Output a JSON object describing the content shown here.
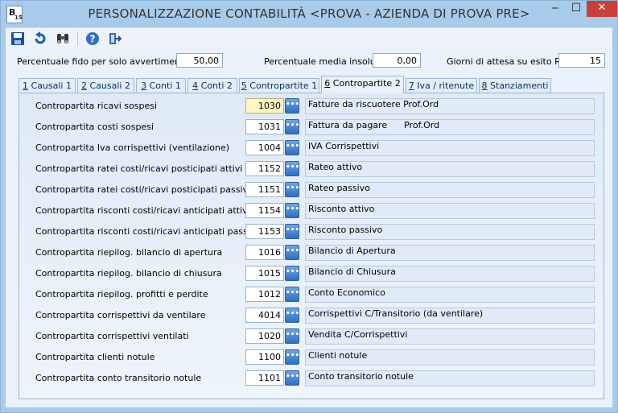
{
  "window": {
    "title": "PERSONALIZZAZIONE CONTABILITÀ <PROVA - AZIENDA DI PROVA PRE>",
    "icon_letter": "B",
    "icon_number": "15",
    "minimize_glyph": "‒",
    "maximize_glyph": "☐",
    "close_glyph": "✕"
  },
  "toolbar": {
    "icons": [
      "save-icon",
      "undo-icon",
      "binoculars-icon",
      "help-icon",
      "exit-icon"
    ]
  },
  "header_fields": [
    {
      "label": "Percentuale fido per solo avvertimento",
      "value": "50,00"
    },
    {
      "label": "Percentuale media insoluti",
      "value": "0,00"
    },
    {
      "label": "Giorni di attesa su esito RB",
      "value": "15"
    }
  ],
  "tabs": [
    {
      "num": "1",
      "label": " Causali 1"
    },
    {
      "num": "2",
      "label": " Causali 2"
    },
    {
      "num": "3",
      "label": " Conti 1"
    },
    {
      "num": "4",
      "label": " Conti 2"
    },
    {
      "num": "5",
      "label": " Contropartite 1"
    },
    {
      "num": "6",
      "label": " Contropartite 2"
    },
    {
      "num": "7",
      "label": " Iva / ritenute"
    },
    {
      "num": "8",
      "label": " Stanziamenti"
    }
  ],
  "active_tab_index": 5,
  "rows": [
    {
      "label": "Contropartita ricavi sospesi",
      "code": "1030",
      "description": "Fatture da riscuotere Prof.Ord"
    },
    {
      "label": "Contropartita costi sospesi",
      "code": "1031",
      "description": "Fattura da pagare      Prof.Ord"
    },
    {
      "label": "Contropartita Iva corrispettivi (ventilazione)",
      "code": "1004",
      "description": "IVA Corrispettivi"
    },
    {
      "label": "Contropartita ratei costi/ricavi posticipati attivi",
      "code": "1152",
      "description": "Rateo attivo"
    },
    {
      "label": "Contropartita ratei costi/ricavi posticipati passivi",
      "code": "1151",
      "description": "Rateo passivo"
    },
    {
      "label": "Contropartita risconti costi/ricavi anticipati attivi",
      "code": "1154",
      "description": "Risconto attivo"
    },
    {
      "label": "Contropartita risconti costi/ricavi anticipati passivi",
      "code": "1153",
      "description": "Risconto passivo"
    },
    {
      "label": "Contropartita riepilog. bilancio di apertura",
      "code": "1016",
      "description": "Bilancio di Apertura"
    },
    {
      "label": "Contropartita riepilog. bilancio di chiusura",
      "code": "1015",
      "description": "Bilancio di Chiusura"
    },
    {
      "label": "Contropartita riepilog. profitti e perdite",
      "code": "1012",
      "description": "Conto Economico"
    },
    {
      "label": "Contropartita corrispettivi da ventilare",
      "code": "4014",
      "description": "Corrispettivi C/Transitorio (da ventilare)"
    },
    {
      "label": "Contropartita corrispettivi ventilati",
      "code": "1020",
      "description": "Vendita C/Corrispettivi"
    },
    {
      "label": "Contropartita clienti notule",
      "code": "1100",
      "description": "Clienti notule"
    },
    {
      "label": "Contropartita conto transitorio notule",
      "code": "1101",
      "description": "Conto transitorio notule"
    }
  ],
  "lookup_glyph": "•••",
  "colors": {
    "frame": "#a8cbe9",
    "content_bg": "#e9f1fb",
    "active_field": "#fff7c4",
    "lookup_button": "#2e6fbf",
    "close_button": "#c7403a"
  }
}
